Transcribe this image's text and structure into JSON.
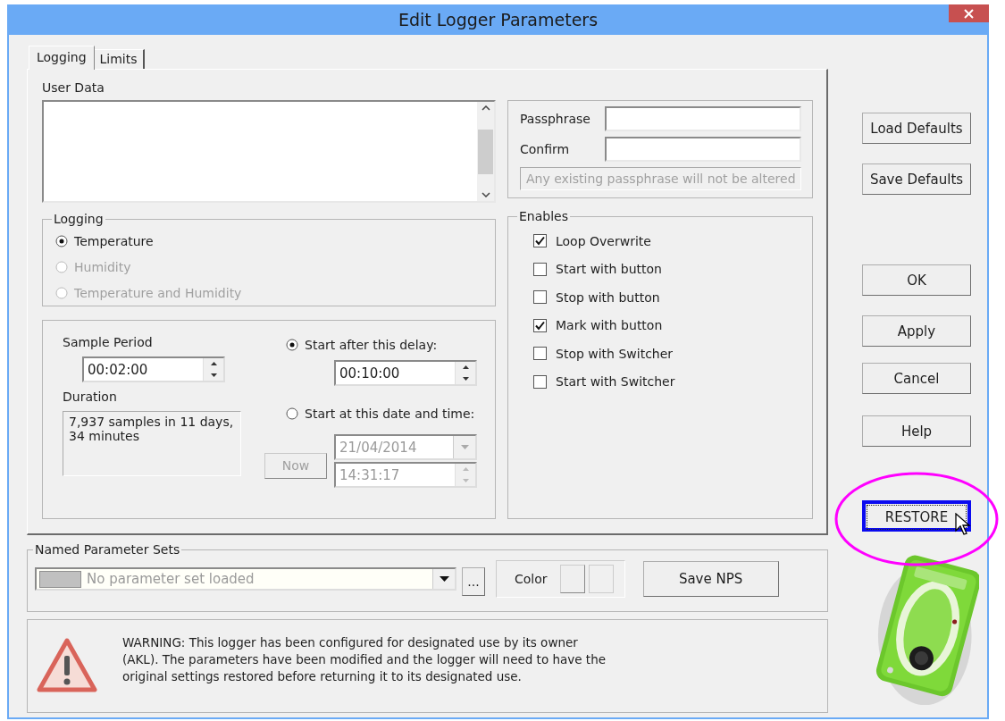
{
  "window": {
    "title": "Edit Logger Parameters"
  },
  "tabs": [
    {
      "label": "Logging",
      "selected": true
    },
    {
      "label": "Limits",
      "selected": false
    }
  ],
  "user_data": {
    "label": "User Data"
  },
  "logging": {
    "title": "Logging",
    "options": [
      {
        "label": "Temperature",
        "selected": true,
        "disabled": false
      },
      {
        "label": "Humidity",
        "selected": false,
        "disabled": true
      },
      {
        "label": "Temperature and Humidity",
        "selected": false,
        "disabled": true
      }
    ]
  },
  "schedule": {
    "sample_period": {
      "label": "Sample Period",
      "value": "00:02:00"
    },
    "duration": {
      "label": "Duration",
      "value": "7,937 samples in 11 days,\n34 minutes"
    },
    "start_options": [
      {
        "label": "Start after this delay:",
        "selected": true
      },
      {
        "label": "Start at this date and time:",
        "selected": false
      }
    ],
    "delay": {
      "value": "00:10:00"
    },
    "now_button": {
      "label": "Now",
      "disabled": true
    },
    "date": {
      "value": "21/04/2014",
      "disabled": true
    },
    "time": {
      "value": "14:31:17",
      "disabled": true
    }
  },
  "passphrase": {
    "fields": [
      {
        "label": "Passphrase"
      },
      {
        "label": "Confirm"
      }
    ],
    "note": "Any existing passphrase will not be altered"
  },
  "enables": {
    "title": "Enables",
    "items": [
      {
        "label": "Loop Overwrite",
        "checked": true
      },
      {
        "label": "Start with button",
        "checked": false
      },
      {
        "label": "Stop with button",
        "checked": false
      },
      {
        "label": "Mark with button",
        "checked": true
      },
      {
        "label": "Stop with Switcher",
        "checked": false
      },
      {
        "label": "Start with Switcher",
        "checked": false
      }
    ]
  },
  "side_buttons": [
    {
      "label": "Load Defaults",
      "focused": false,
      "highlighted": false
    },
    {
      "label": "Save Defaults",
      "focused": false,
      "highlighted": false
    },
    {
      "label": "OK",
      "focused": false,
      "highlighted": false
    },
    {
      "label": "Apply",
      "focused": false,
      "highlighted": false
    },
    {
      "label": "Cancel",
      "focused": false,
      "highlighted": false
    },
    {
      "label": "Help",
      "focused": false,
      "highlighted": false
    },
    {
      "label": "RESTORE",
      "focused": true,
      "highlighted": true
    }
  ],
  "named_parameter_sets": {
    "title": "Named Parameter Sets",
    "placeholder": "No parameter set loaded",
    "browse_label": "...",
    "color_label": "Color",
    "save_label": "Save NPS"
  },
  "warning": {
    "text": "WARNING: This logger has been configured for designated use by its owner\n(AKL). The parameters have been modified and the logger will need to have the\noriginal settings restored before returning it to its designated use."
  }
}
